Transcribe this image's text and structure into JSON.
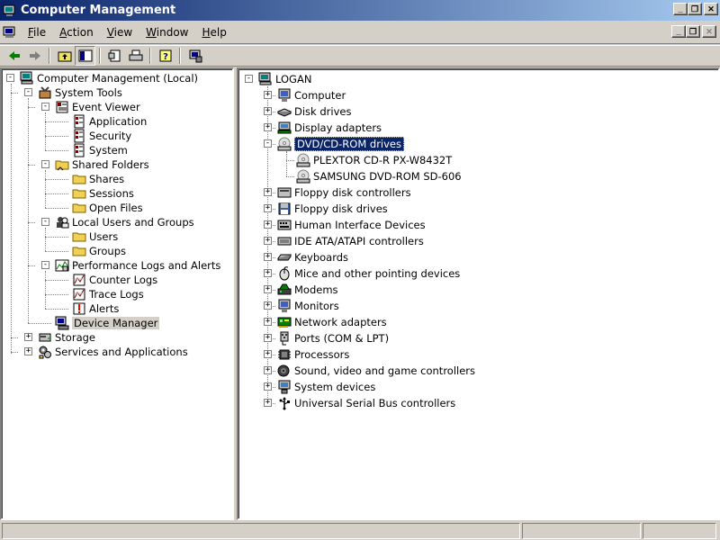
{
  "window": {
    "title": "Computer Management",
    "caption_buttons": [
      "_",
      "❐",
      "✕"
    ]
  },
  "menubar": {
    "items": [
      {
        "label": "File",
        "access": "F"
      },
      {
        "label": "Action",
        "access": "A"
      },
      {
        "label": "View",
        "access": "V"
      },
      {
        "label": "Window",
        "access": "W"
      },
      {
        "label": "Help",
        "access": "H"
      }
    ]
  },
  "toolbar": {
    "buttons": [
      "back-icon",
      "forward-icon",
      "up-folder-icon",
      "show-tree-icon",
      "properties-icon",
      "print-icon",
      "help-icon",
      "device-manager-icon"
    ]
  },
  "left_tree": {
    "nodes": [
      {
        "label": "Computer Management (Local)",
        "icon": "computer-icon"
      },
      {
        "label": "System Tools",
        "icon": "tools-icon"
      },
      {
        "label": "Event Viewer",
        "icon": "event-viewer-icon"
      },
      {
        "label": "Application",
        "icon": "log-icon"
      },
      {
        "label": "Security",
        "icon": "log-icon"
      },
      {
        "label": "System",
        "icon": "log-icon"
      },
      {
        "label": "Shared Folders",
        "icon": "shared-folder-icon"
      },
      {
        "label": "Shares",
        "icon": "folder-icon"
      },
      {
        "label": "Sessions",
        "icon": "folder-icon"
      },
      {
        "label": "Open Files",
        "icon": "folder-icon"
      },
      {
        "label": "Local Users and Groups",
        "icon": "users-icon"
      },
      {
        "label": "Users",
        "icon": "folder-icon"
      },
      {
        "label": "Groups",
        "icon": "folder-icon"
      },
      {
        "label": "Performance Logs and Alerts",
        "icon": "performance-icon"
      },
      {
        "label": "Counter Logs",
        "icon": "chart-icon"
      },
      {
        "label": "Trace Logs",
        "icon": "chart-icon"
      },
      {
        "label": "Alerts",
        "icon": "alert-icon"
      },
      {
        "label": "Device Manager",
        "icon": "device-manager-icon"
      },
      {
        "label": "Storage",
        "icon": "storage-icon"
      },
      {
        "label": "Services and Applications",
        "icon": "services-icon"
      }
    ]
  },
  "right_tree": {
    "nodes": [
      {
        "label": "LOGAN",
        "icon": "computer-icon"
      },
      {
        "label": "Computer",
        "icon": "monitor-icon"
      },
      {
        "label": "Disk drives",
        "icon": "disk-drive-icon"
      },
      {
        "label": "Display adapters",
        "icon": "display-adapter-icon"
      },
      {
        "label": "DVD/CD-ROM drives",
        "icon": "cdrom-icon"
      },
      {
        "label": "PLEXTOR CD-R   PX-W8432T",
        "icon": "cdrom-icon"
      },
      {
        "label": "SAMSUNG DVD-ROM SD-606",
        "icon": "cdrom-icon"
      },
      {
        "label": "Floppy disk controllers",
        "icon": "floppy-controller-icon"
      },
      {
        "label": "Floppy disk drives",
        "icon": "floppy-drive-icon"
      },
      {
        "label": "Human Interface Devices",
        "icon": "hid-icon"
      },
      {
        "label": "IDE ATA/ATAPI controllers",
        "icon": "ide-controller-icon"
      },
      {
        "label": "Keyboards",
        "icon": "keyboard-icon"
      },
      {
        "label": "Mice and other pointing devices",
        "icon": "mouse-icon"
      },
      {
        "label": "Modems",
        "icon": "modem-icon"
      },
      {
        "label": "Monitors",
        "icon": "monitor-icon"
      },
      {
        "label": "Network adapters",
        "icon": "network-adapter-icon"
      },
      {
        "label": "Ports (COM & LPT)",
        "icon": "port-icon"
      },
      {
        "label": "Processors",
        "icon": "processor-icon"
      },
      {
        "label": "Sound, video and game controllers",
        "icon": "sound-icon"
      },
      {
        "label": "System devices",
        "icon": "system-device-icon"
      },
      {
        "label": "Universal Serial Bus controllers",
        "icon": "usb-icon"
      }
    ]
  },
  "colors": {
    "title_start": "#0a246a",
    "title_end": "#a6caf0",
    "window_bg": "#d4d0c8",
    "pane_bg": "#ffffff",
    "selection": "#0a246a"
  }
}
